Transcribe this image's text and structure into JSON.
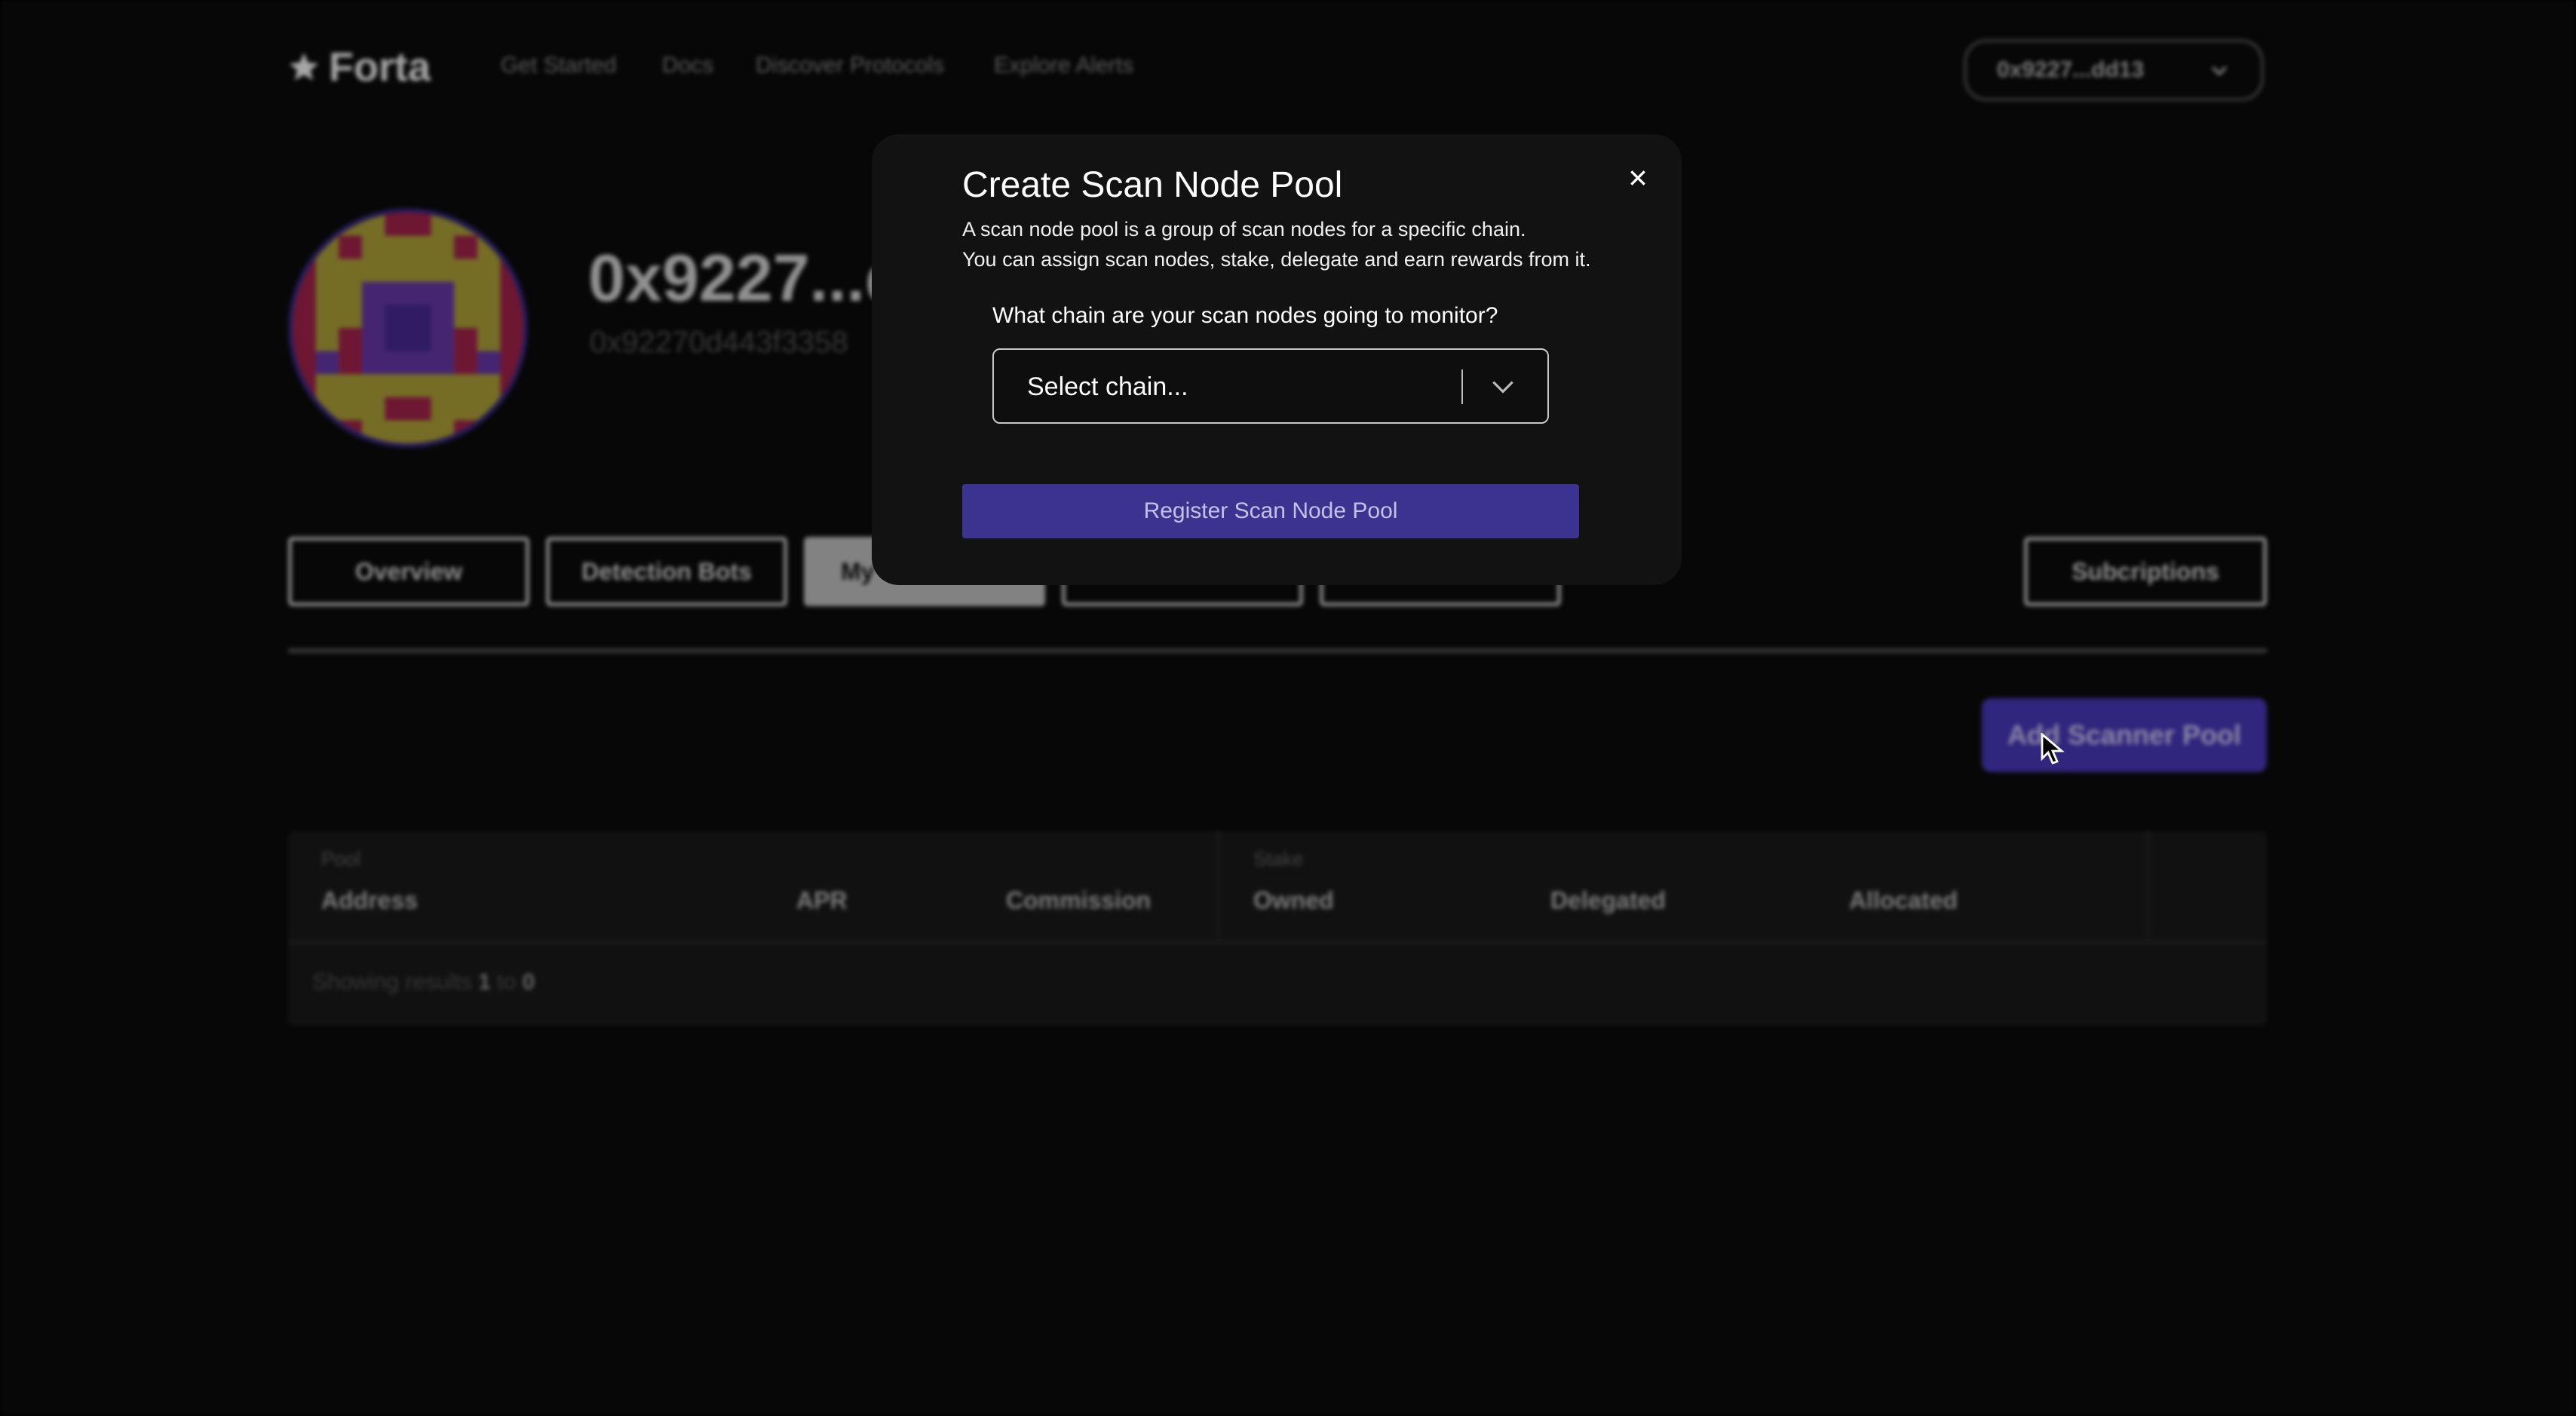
{
  "header": {
    "logo_text": "Forta",
    "logo_icon": "star-icon",
    "nav": [
      "Get Started",
      "Docs",
      "Discover Protocols",
      "Explore Alerts"
    ],
    "wallet_label": "0x9227...dd13"
  },
  "profile": {
    "title": "0x9227...d",
    "address": "0x92270d443f3358"
  },
  "tabs": [
    {
      "label": "Overview"
    },
    {
      "label": "Detection Bots"
    },
    {
      "label": "My"
    },
    {
      "label": ""
    },
    {
      "label": ""
    },
    {
      "label": "Subcriptions"
    }
  ],
  "actions": {
    "add_pool_label": "Add Scanner Pool"
  },
  "table": {
    "group_pool": "Pool",
    "group_stake": "Stake",
    "columns": [
      "Address",
      "APR",
      "Commission",
      "Owned",
      "Delegated",
      "Allocated"
    ],
    "showing_prefix": "Showing results",
    "showing_from": "1",
    "showing_to_word": "to",
    "showing_to": "0"
  },
  "modal": {
    "title": "Create Scan Node Pool",
    "desc_line1": "A scan node pool is a group of scan nodes for a specific chain.",
    "desc_line2": "You can assign scan nodes, stake, delegate and earn rewards from it.",
    "question": "What chain are your scan nodes going to monitor?",
    "select_placeholder": "Select chain...",
    "register_label": "Register Scan Node Pool"
  },
  "colors": {
    "accent": "#4a3bc0",
    "register_button": "#3c3391",
    "modal_bg": "#121212"
  }
}
